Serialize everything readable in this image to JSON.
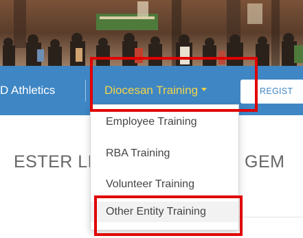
{
  "navbar": {
    "athletics_label": "D Athletics",
    "diocesan_label": "Diocesan Training",
    "register_label": "REGIST",
    "accent_color": "#f2d44a",
    "background_color": "#3e86c4"
  },
  "dropdown": {
    "items": [
      {
        "label": "Employee Training"
      },
      {
        "label": "RBA Training"
      },
      {
        "label": "Volunteer Training"
      },
      {
        "label": "Other Entity Training"
      }
    ]
  },
  "page": {
    "heading_left": "ESTER LE",
    "heading_right": "GEM"
  },
  "annotations": {
    "color": "#e00000"
  }
}
